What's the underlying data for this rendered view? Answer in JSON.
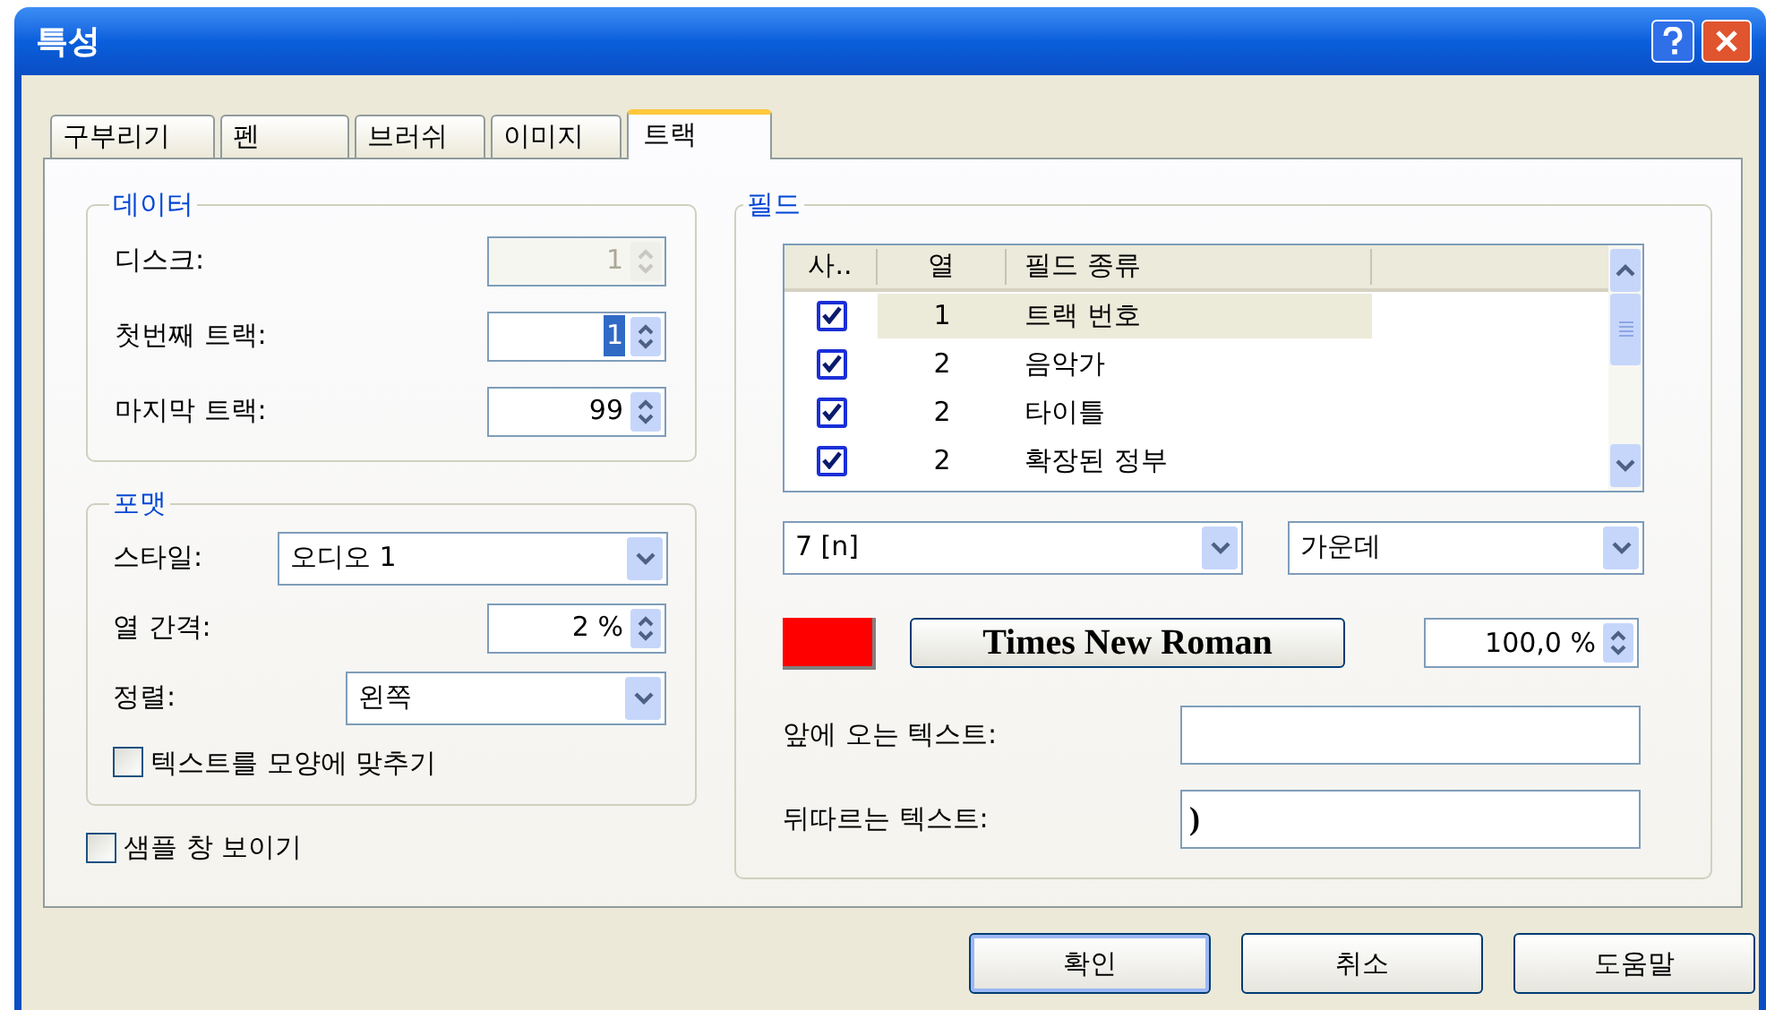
{
  "window": {
    "title": "특성"
  },
  "tabs": [
    {
      "label": "구부리기",
      "selected": false
    },
    {
      "label": "펜",
      "selected": false
    },
    {
      "label": "브러쉬",
      "selected": false
    },
    {
      "label": "이미지",
      "selected": false
    },
    {
      "label": "트랙",
      "selected": true
    }
  ],
  "data_group": {
    "title": "데이터",
    "fields": [
      {
        "label": "디스크:",
        "value": "1",
        "disabled": true,
        "value_selected": false
      },
      {
        "label": "첫번째 트랙:",
        "value": "1",
        "disabled": false,
        "value_selected": true
      },
      {
        "label": "마지막 트랙:",
        "value": "99",
        "disabled": false,
        "value_selected": false
      }
    ]
  },
  "format_group": {
    "title": "포맷",
    "style": {
      "label": "스타일:",
      "value": "오디오 1"
    },
    "spacing": {
      "label": "열 간격:",
      "value": "2 %"
    },
    "alignment": {
      "label": "정렬:",
      "value": "왼쪽"
    },
    "fit_text": {
      "label": "텍스트를 모양에 맞추기",
      "checked": false
    }
  },
  "show_sample": {
    "label": "샘플 창 보이기",
    "checked": false
  },
  "field_group": {
    "title": "필드",
    "columns": [
      "사..",
      "열",
      "필드 종류"
    ],
    "rows": [
      {
        "checked": true,
        "column": "1",
        "type": "트랙 번호",
        "selected": true
      },
      {
        "checked": true,
        "column": "2",
        "type": "음악가",
        "selected": false
      },
      {
        "checked": true,
        "column": "2",
        "type": "타이틀",
        "selected": false
      },
      {
        "checked": true,
        "column": "2",
        "type": "확장된 정부",
        "selected": false
      }
    ],
    "numbering": "7 [n]",
    "alignment": "가운데",
    "color": "#ff0000",
    "font": "Times New Roman",
    "size": "100,0 %",
    "prefix": {
      "label": "앞에 오는 텍스트:"
    },
    "suffix": {
      "label": "뒤따르는 텍스트:",
      "value": ")"
    }
  },
  "buttons": [
    {
      "label": "확인",
      "default": true
    },
    {
      "label": "취소",
      "default": false
    },
    {
      "label": "도움말",
      "default": false
    }
  ]
}
